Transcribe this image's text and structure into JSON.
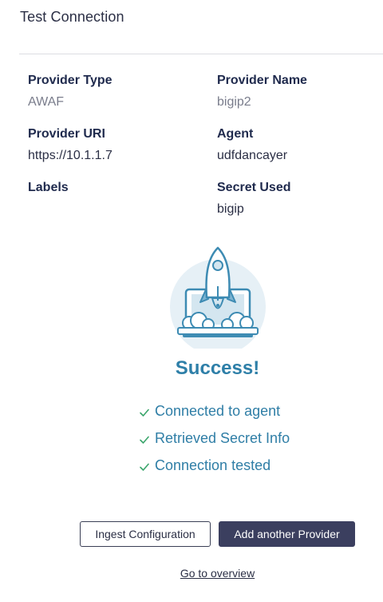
{
  "header": {
    "title": "Test Connection"
  },
  "details": {
    "provider_type": {
      "label": "Provider Type",
      "value": "AWAF"
    },
    "provider_name": {
      "label": "Provider Name",
      "value": "bigip2"
    },
    "provider_uri": {
      "label": "Provider URI",
      "value": "https://10.1.1.7"
    },
    "agent": {
      "label": "Agent",
      "value": "udfdancayer"
    },
    "labels": {
      "label": "Labels",
      "value": ""
    },
    "secret_used": {
      "label": "Secret Used",
      "value": "bigip"
    }
  },
  "result": {
    "illustration_icon": "rocket-launch-laptop-icon",
    "heading": "Success!",
    "checks": [
      {
        "icon": "checkmark-icon",
        "text": "Connected to agent"
      },
      {
        "icon": "checkmark-icon",
        "text": "Retrieved Secret Info"
      },
      {
        "icon": "checkmark-icon",
        "text": "Connection tested"
      }
    ]
  },
  "actions": {
    "ingest_label": "Ingest Configuration",
    "add_provider_label": "Add another Provider",
    "overview_link": "Go to overview"
  },
  "colors": {
    "accent": "#2e7fa8",
    "check": "#3aa56b",
    "primary_button": "#3b3f5f"
  }
}
